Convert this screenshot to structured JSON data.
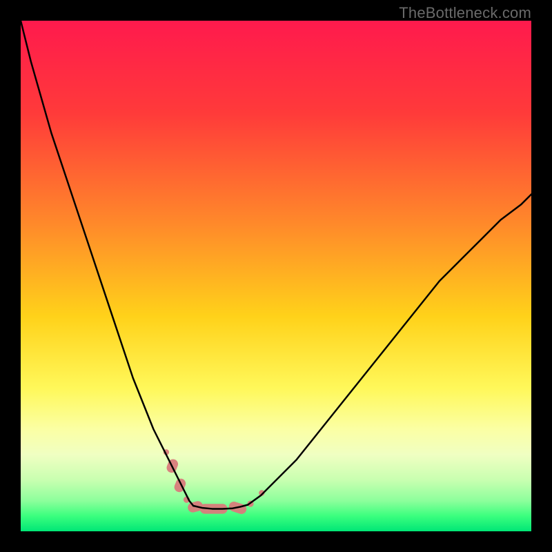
{
  "watermark": "TheBottleneck.com",
  "chart_data": {
    "type": "line",
    "title": "",
    "xlabel": "",
    "ylabel": "",
    "xlim": [
      0,
      100
    ],
    "ylim": [
      0,
      100
    ],
    "grid": false,
    "legend": false,
    "annotations": [],
    "background_gradient_stops": [
      {
        "pct": 0.0,
        "color": "#ff1a4d"
      },
      {
        "pct": 0.18,
        "color": "#ff3a3a"
      },
      {
        "pct": 0.4,
        "color": "#ff8a2a"
      },
      {
        "pct": 0.58,
        "color": "#ffd21a"
      },
      {
        "pct": 0.72,
        "color": "#fff85a"
      },
      {
        "pct": 0.8,
        "color": "#fbffa4"
      },
      {
        "pct": 0.85,
        "color": "#f0ffc2"
      },
      {
        "pct": 0.9,
        "color": "#c8ffb0"
      },
      {
        "pct": 0.94,
        "color": "#8dff9c"
      },
      {
        "pct": 0.97,
        "color": "#3bff7e"
      },
      {
        "pct": 1.0,
        "color": "#00e676"
      }
    ],
    "series": [
      {
        "name": "left-branch",
        "stroke": "#000000",
        "stroke_width": 2.5,
        "x": [
          0,
          2,
          4,
          6,
          8,
          10,
          12,
          14,
          16,
          18,
          20,
          22,
          24,
          26,
          28,
          30,
          31,
          32,
          33,
          33.8
        ],
        "y": [
          100,
          92,
          85,
          78,
          72,
          66,
          60,
          54,
          48,
          42,
          36,
          30,
          25,
          20,
          16,
          12,
          10,
          8,
          6,
          5
        ]
      },
      {
        "name": "valley-floor",
        "stroke": "#000000",
        "stroke_width": 2.5,
        "x": [
          33.8,
          35.5,
          37.5,
          39.5,
          41.5,
          43.0,
          44.5
        ],
        "y": [
          5.0,
          4.6,
          4.4,
          4.4,
          4.5,
          4.8,
          5.2
        ]
      },
      {
        "name": "right-branch",
        "stroke": "#000000",
        "stroke_width": 2.5,
        "x": [
          44.5,
          47,
          50,
          54,
          58,
          62,
          66,
          70,
          74,
          78,
          82,
          86,
          90,
          94,
          98,
          100
        ],
        "y": [
          5.2,
          7,
          10,
          14,
          19,
          24,
          29,
          34,
          39,
          44,
          49,
          53,
          57,
          61,
          64,
          66
        ]
      }
    ],
    "markers": {
      "name": "fitted-salmon-markers",
      "fill": "#d97b7b",
      "opacity": 0.95,
      "points": [
        {
          "x": 28.5,
          "y": 15.5,
          "r": 4.2,
          "shape": "circle"
        },
        {
          "x": 29.7,
          "y": 12.8,
          "r": 7.2,
          "shape": "pill",
          "angle": -68,
          "len": 20
        },
        {
          "x": 31.2,
          "y": 9.0,
          "r": 7.2,
          "shape": "pill",
          "angle": -68,
          "len": 20
        },
        {
          "x": 32.5,
          "y": 6.2,
          "r": 4.6,
          "shape": "circle"
        },
        {
          "x": 34.2,
          "y": 4.8,
          "r": 7.2,
          "shape": "pill",
          "angle": -15,
          "len": 22
        },
        {
          "x": 37.8,
          "y": 4.4,
          "r": 7.2,
          "shape": "pill",
          "angle": 0,
          "len": 40
        },
        {
          "x": 42.5,
          "y": 4.6,
          "r": 7.2,
          "shape": "pill",
          "angle": 18,
          "len": 26
        },
        {
          "x": 45.0,
          "y": 5.4,
          "r": 4.6,
          "shape": "circle"
        },
        {
          "x": 47.2,
          "y": 7.5,
          "r": 4.2,
          "shape": "circle"
        }
      ]
    }
  }
}
